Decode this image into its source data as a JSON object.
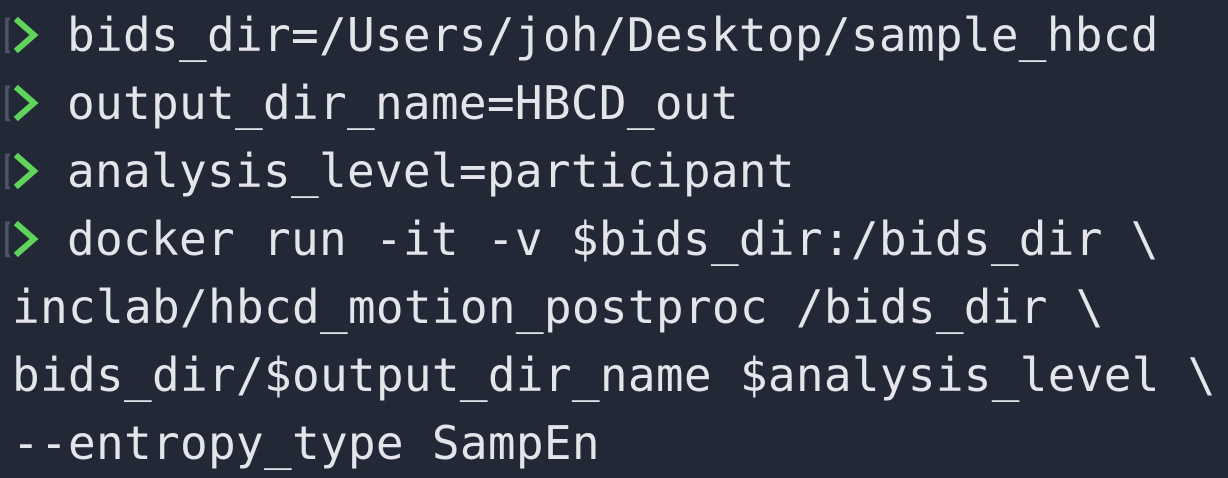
{
  "terminal": {
    "prompt_lines": [
      "bids_dir=/Users/joh/Desktop/sample_hbcd",
      "output_dir_name=HBCD_out",
      "analysis_level=participant",
      "docker run -it -v $bids_dir:/bids_dir \\"
    ],
    "continuation_lines": [
      "inclab/hbcd_motion_postproc /bids_dir \\",
      "bids_dir/$output_dir_name $analysis_level \\",
      "--entropy_type SampEn"
    ],
    "prompt_symbol": "❯",
    "bracket_char": "[",
    "colors": {
      "background": "#232837",
      "text": "#e3e5ea",
      "prompt": "#5fd35a",
      "bracket": "#4a5265"
    },
    "icons": {
      "prompt": "chevron-right-icon"
    }
  }
}
